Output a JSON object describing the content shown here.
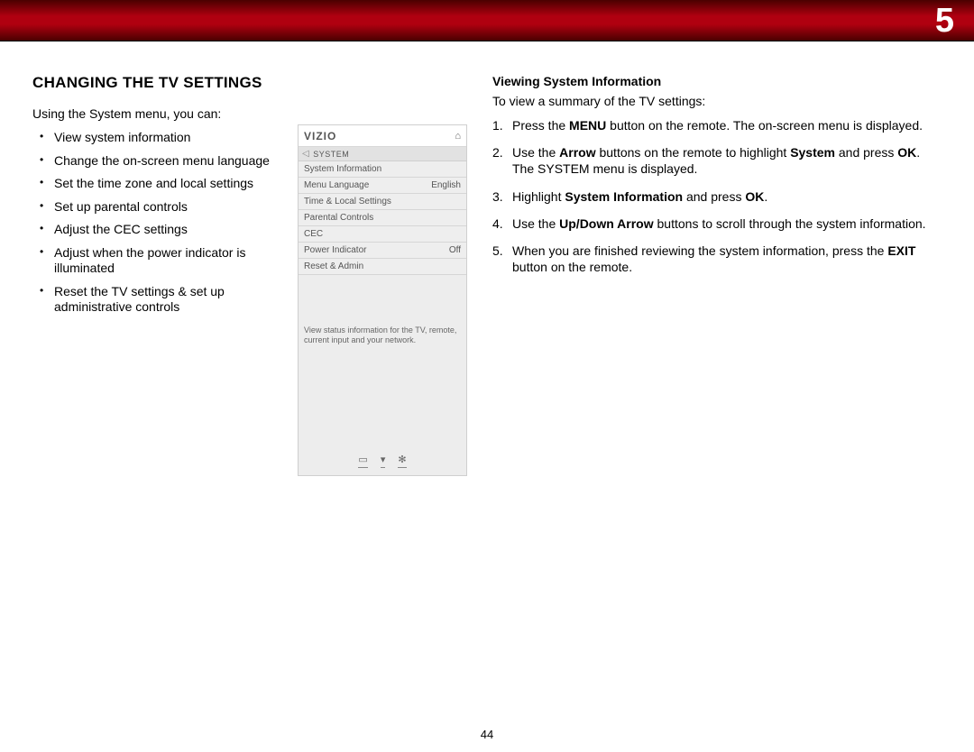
{
  "chapter_number": "5",
  "page_number": "44",
  "left": {
    "title": "CHANGING THE TV SETTINGS",
    "intro": "Using the System menu, you can:",
    "bullets": [
      "View system information",
      "Change the on-screen menu language",
      "Set the time zone and local settings",
      "Set up parental controls",
      "Adjust the CEC settings",
      "Adjust when the power indicator is illuminated",
      "Reset the TV settings & set up administrative controls"
    ]
  },
  "osd": {
    "logo": "VIZIO",
    "crumb": "SYSTEM",
    "rows": [
      {
        "label": "System Information",
        "value": ""
      },
      {
        "label": "Menu Language",
        "value": "English"
      },
      {
        "label": "Time & Local Settings",
        "value": ""
      },
      {
        "label": "Parental Controls",
        "value": ""
      },
      {
        "label": "CEC",
        "value": ""
      },
      {
        "label": "Power Indicator",
        "value": "Off"
      },
      {
        "label": "Reset & Admin",
        "value": ""
      }
    ],
    "help_text": "View status information for the TV, remote, current input and your network."
  },
  "right": {
    "subhead": "Viewing System Information",
    "lead": "To view a summary of the TV settings:",
    "steps": [
      {
        "pre": "Press the ",
        "b1": "MENU",
        "mid": " button on the remote. The on-screen menu is displayed.",
        "b2": "",
        "post": ""
      },
      {
        "pre": "Use the ",
        "b1": "Arrow",
        "mid": " buttons on the remote to highlight ",
        "b2": "System",
        "post": " and press ",
        "b3": "OK",
        "tail": ". The SYSTEM menu is displayed."
      },
      {
        "pre": "Highlight ",
        "b1": "System Information",
        "mid": " and press ",
        "b2": "OK",
        "post": "."
      },
      {
        "pre": "Use the ",
        "b1": "Up/Down Arrow",
        "mid": " buttons to scroll through the system information.",
        "b2": "",
        "post": ""
      },
      {
        "pre": "When you are finished reviewing the system information, press the ",
        "b1": "EXIT",
        "mid": " button on the remote.",
        "b2": "",
        "post": ""
      }
    ]
  }
}
